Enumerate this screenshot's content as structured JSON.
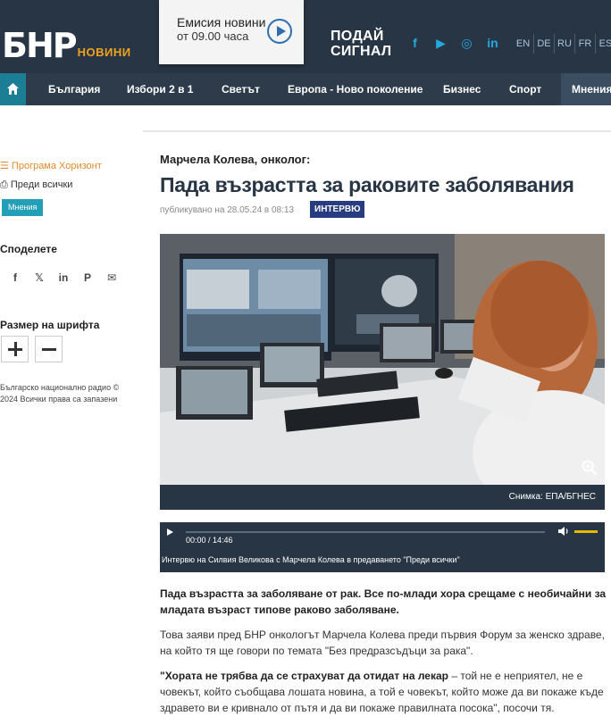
{
  "header": {
    "logo_main": "БНР",
    "logo_sub": "НОВИНИ",
    "emisia_title": "Емисия новини",
    "emisia_time": "от 09.00 часа",
    "podai_line1": "ПОДАЙ",
    "podai_line2": "СИГНАЛ",
    "socials": [
      "f",
      "▶",
      "◎",
      "in"
    ],
    "languages": [
      "EN",
      "DE",
      "RU",
      "FR",
      "ES"
    ]
  },
  "nav": {
    "items": [
      "България",
      "Избори 2 в 1",
      "Светът",
      "Европа - Ново поколение",
      "Бизнес",
      "Спорт",
      "Мнения"
    ]
  },
  "sidebar": {
    "program": "Програма Хоризонт",
    "show": "Преди всички",
    "category": "Мнения",
    "share_heading": "Споделете",
    "share_icons": [
      "f",
      "𝕏",
      "in",
      "P",
      "✉"
    ],
    "font_heading": "Размер на шрифта",
    "copyright_line1": "Българско национално радио ©",
    "copyright_line2": "2024 Всички права са запазени"
  },
  "article": {
    "kicker": "Марчела Колева, онколог:",
    "title": "Пада възрастта за раковите заболявания",
    "published": "публикувано на 28.05.24 в 08:13",
    "tag": "ИНТЕРВЮ",
    "photo_credit": "Снимка: ЕПА/БГНЕС",
    "audio_time": "00:00 / 14:46",
    "audio_caption": "Интервю на Силвия Великова с Марчела Колева в предаването \"Преди всички\"",
    "lead": "Пада възрастта за заболяване от рак. Все по-млади хора срещаме с необичайни за младата възраст типове раково заболяване.",
    "para1": "Това заяви пред БНР онкологът Марчела Колева преди първия Форум за женско здраве, на който тя ще говори по темата \"Без предразсъдъци за рака\".",
    "para2_bold": "\"Хората не трябва да се страхуват да отидат на лекар",
    "para2_rest": " – той не е неприятел, не е човекът, който съобщава лошата новина, а той е човекът, който може да ви покаже къде здравето ви е кривнало от пътя и да ви покаже правилната посока\", посочи тя."
  }
}
